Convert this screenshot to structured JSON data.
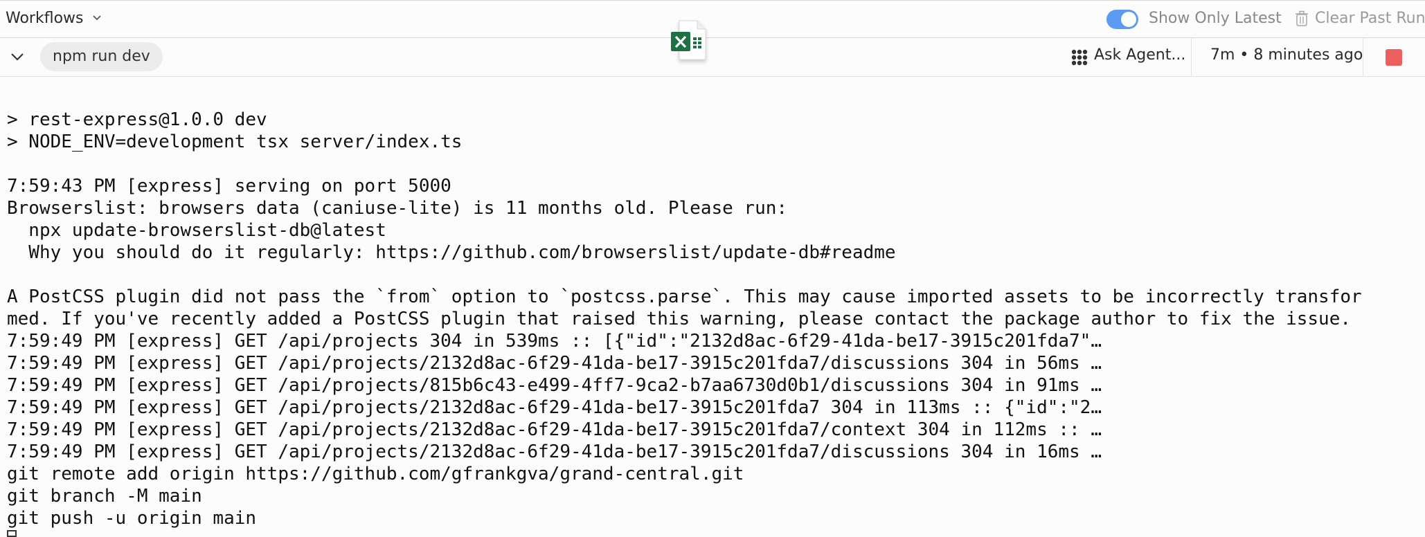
{
  "header": {
    "workflows_label": "Workflows",
    "show_only_latest_label": "Show Only Latest",
    "show_only_latest_on": true,
    "clear_past_runs_label": "Clear Past Run"
  },
  "run": {
    "command": "npm run dev",
    "ask_agent_label": "Ask Agent...",
    "elapsed": "7m • 8 minutes ago"
  },
  "console": {
    "lines": [
      "",
      "> rest-express@1.0.0 dev",
      "> NODE_ENV=development tsx server/index.ts",
      "",
      "7:59:43 PM [express] serving on port 5000",
      "Browserslist: browsers data (caniuse-lite) is 11 months old. Please run:",
      "  npx update-browserslist-db@latest",
      "  Why you should do it regularly: https://github.com/browserslist/update-db#readme",
      "",
      "A PostCSS plugin did not pass the `from` option to `postcss.parse`. This may cause imported assets to be incorrectly transfor",
      "med. If you've recently added a PostCSS plugin that raised this warning, please contact the package author to fix the issue.",
      "7:59:49 PM [express] GET /api/projects 304 in 539ms :: [{\"id\":\"2132d8ac-6f29-41da-be17-3915c201fda7\"…",
      "7:59:49 PM [express] GET /api/projects/2132d8ac-6f29-41da-be17-3915c201fda7/discussions 304 in 56ms …",
      "7:59:49 PM [express] GET /api/projects/815b6c43-e499-4ff7-9ca2-b7aa6730d0b1/discussions 304 in 91ms …",
      "7:59:49 PM [express] GET /api/projects/2132d8ac-6f29-41da-be17-3915c201fda7 304 in 113ms :: {\"id\":\"2…",
      "7:59:49 PM [express] GET /api/projects/2132d8ac-6f29-41da-be17-3915c201fda7/context 304 in 112ms :: …",
      "7:59:49 PM [express] GET /api/projects/2132d8ac-6f29-41da-be17-3915c201fda7/discussions 304 in 16ms …",
      "git remote add origin https://github.com/gfrankgva/grand-central.git",
      "git branch -M main",
      "git push -u origin main"
    ]
  },
  "icons": {
    "workflows_dropdown": "chevron-down-icon",
    "collapse": "chevron-down-icon",
    "agent": "agent-icon",
    "trash": "trash-icon",
    "file": "excel-file-icon",
    "stop": "stop-icon"
  },
  "colors": {
    "toggle_on": "#5b9cf2",
    "stop": "#ec5f5f",
    "excel_green": "#1e7145"
  }
}
